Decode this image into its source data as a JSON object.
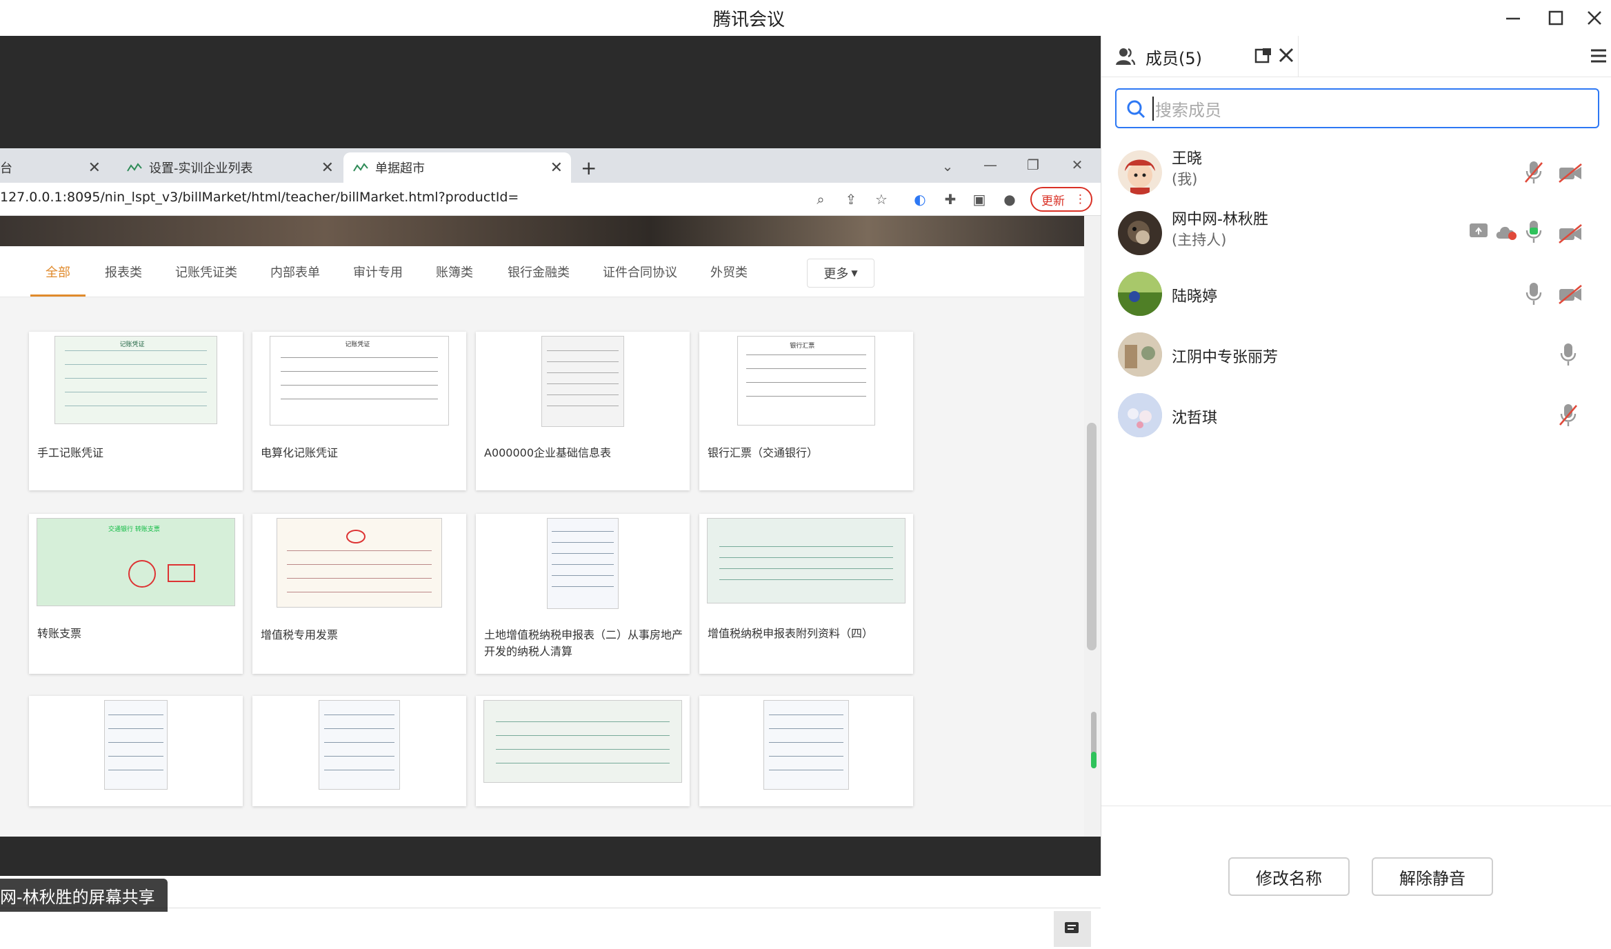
{
  "app": {
    "title": "腾讯会议"
  },
  "browser": {
    "tabs": [
      {
        "label": "台"
      },
      {
        "label": "设置-实训企业列表"
      },
      {
        "label": "单据超市"
      }
    ],
    "new_tab": "+",
    "url": "127.0.0.1:8095/nin_lspt_v3/billMarket/html/teacher/billMarket.html?productId=",
    "update_label": "更新"
  },
  "categories": {
    "items": [
      "全部",
      "报表类",
      "记账凭证类",
      "内部表单",
      "审计专用",
      "账簿类",
      "银行金融类",
      "证件合同协议",
      "外贸类"
    ],
    "active": "全部",
    "more_label": "更多"
  },
  "cards": [
    {
      "label": "手工记账凭证",
      "thumb_header": "记账凭证"
    },
    {
      "label": "电算化记账凭证",
      "thumb_header": "记账凭证"
    },
    {
      "label": "A000000企业基础信息表",
      "thumb_header": ""
    },
    {
      "label": "银行汇票（交通银行）",
      "thumb_header": "银行汇票"
    },
    {
      "label": "转账支票",
      "thumb_header": "交通银行 转账支票"
    },
    {
      "label": "增值税专用发票",
      "thumb_header": ""
    },
    {
      "label": "土地增值税纳税申报表（二）从事房地产开发的纳税人清算",
      "thumb_header": ""
    },
    {
      "label": "增值税纳税申报表附列资料（四）",
      "thumb_header": ""
    },
    {
      "label": "",
      "thumb_header": ""
    },
    {
      "label": "",
      "thumb_header": ""
    },
    {
      "label": "",
      "thumb_header": ""
    },
    {
      "label": "",
      "thumb_header": ""
    }
  ],
  "share": {
    "sharer_label": "网-林秋胜的屏幕共享"
  },
  "panel": {
    "members_title": "成员(5)",
    "search_placeholder": "搜索成员",
    "members": [
      {
        "name": "王晓",
        "role": "(我)",
        "mic": "muted",
        "cam": "off",
        "avatar_color": "#e7b08a"
      },
      {
        "name": "网中网-林秋胜",
        "role": "(主持人)",
        "mic": "on",
        "cam": "off",
        "sharing": true,
        "avatar_color": "#3b3028"
      },
      {
        "name": "陆晓婷",
        "role": "",
        "mic": "on-gray",
        "cam": "off",
        "avatar_color": "#6a9a3c"
      },
      {
        "name": "江阴中专张丽芳",
        "role": "",
        "mic": "on-gray",
        "cam": "",
        "avatar_color": "#c9b9a0"
      },
      {
        "name": "沈哲琪",
        "role": "",
        "mic": "muted",
        "cam": "",
        "avatar_color": "#b9c8e6"
      }
    ],
    "rename_label": "修改名称",
    "unmute_label": "解除静音"
  },
  "colors": {
    "accent": "#2d78f4",
    "active_category": "#e08a2c",
    "mic_on": "#2fc25b",
    "muted": "#e0493a"
  }
}
